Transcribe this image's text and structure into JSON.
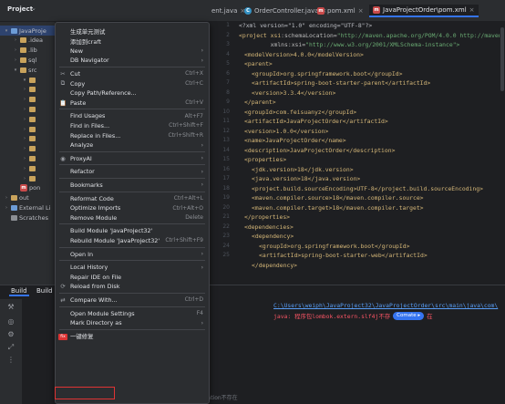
{
  "project_panel": {
    "title": "Project",
    "chevron": "⌄"
  },
  "tabs": [
    {
      "label": "ent.java",
      "icon": "c"
    },
    {
      "label": "OrderController.java",
      "icon": "c"
    },
    {
      "label": "pom.xml",
      "icon": "m"
    },
    {
      "label": "JavaProjectOrder\\pom.xml",
      "icon": "m",
      "active": true
    }
  ],
  "tree": [
    {
      "label": "JavaProje",
      "indent": 4,
      "arrow": "▾",
      "kind": "blue",
      "selected": true
    },
    {
      "label": ".idea",
      "indent": 14,
      "arrow": "›",
      "kind": "folder"
    },
    {
      "label": ".lib",
      "indent": 14,
      "arrow": "›",
      "kind": "folder"
    },
    {
      "label": "sql",
      "indent": 14,
      "arrow": "›",
      "kind": "folder"
    },
    {
      "label": "src",
      "indent": 14,
      "arrow": "▾",
      "kind": "folder"
    },
    {
      "label": "",
      "indent": 24,
      "arrow": "▾",
      "kind": "folder"
    },
    {
      "label": "",
      "indent": 24,
      "arrow": "›",
      "kind": "folder"
    },
    {
      "label": "",
      "indent": 24,
      "arrow": "›",
      "kind": "folder"
    },
    {
      "label": "",
      "indent": 24,
      "arrow": "›",
      "kind": "folder"
    },
    {
      "label": "",
      "indent": 24,
      "arrow": "›",
      "kind": "folder"
    },
    {
      "label": "",
      "indent": 24,
      "arrow": "›",
      "kind": "folder"
    },
    {
      "label": "",
      "indent": 24,
      "arrow": "›",
      "kind": "folder"
    },
    {
      "label": "",
      "indent": 24,
      "arrow": "›",
      "kind": "folder"
    },
    {
      "label": "",
      "indent": 24,
      "arrow": "›",
      "kind": "folder"
    },
    {
      "label": "",
      "indent": 24,
      "arrow": "›",
      "kind": "folder"
    },
    {
      "label": "",
      "indent": 24,
      "arrow": "›",
      "kind": "folder"
    },
    {
      "label": "pon",
      "indent": 14,
      "arrow": "",
      "kind": "pom"
    },
    {
      "label": "out",
      "indent": 4,
      "arrow": "›",
      "kind": "folder"
    },
    {
      "label": "External Li",
      "indent": 4,
      "arrow": "›",
      "kind": "lib"
    },
    {
      "label": "Scratches",
      "indent": 4,
      "arrow": "",
      "kind": "scratch"
    }
  ],
  "line_numbers": [
    "1",
    "2",
    "3",
    "4",
    "5",
    "6",
    "7",
    "8",
    "9",
    "10",
    "11",
    "12",
    "13",
    "14",
    "15",
    "16",
    "17",
    "18",
    "19",
    "20",
    "21",
    "22",
    "23",
    "24",
    "25"
  ],
  "code": {
    "l1": "<?xml version=\"1.0\" encoding=\"UTF-8\"?>",
    "l2a": "<project xsi",
    "l2b": ":schemaLocation=",
    "l2c": "\"http://maven.apache.org/POM/4.0.0 http://maven",
    "l3a": "         xmlns:xsi=",
    "l3b": "\"http://www.w3.org/2001/XMLSchema-instance\">",
    "l4": "<modelVersion>4.0.0</modelVersion>",
    "l5": "<parent>",
    "l6": "<groupId>org.springframework.boot</groupId>",
    "l7": "<artifactId>spring-boot-starter-parent</artifactId>",
    "l8": "<version>3.3.4</version>",
    "l9": "</parent>",
    "l10": "<groupId>com.feisuanyz</groupId>",
    "l11": "<artifactId>JavaProjectOrder</artifactId>",
    "l12": "<version>1.0.0</version>",
    "l13": "<name>JavaProjectOrder</name>",
    "l14": "<description>JavaProjectOrder</description>",
    "l15": "<properties>",
    "l16": "<jdk.version>18</jdk.version>",
    "l17": "<java.version>18</java.version>",
    "l18": "<project.build.sourceEncoding>UTF-8</project.build.sourceEncoding>",
    "l19": "<maven.compiler.source>18</maven.compiler.source>",
    "l20": "<maven.compiler.target>18</maven.compiler.target>",
    "l21": "</properties>",
    "l22": "<dependencies>",
    "l23": "<dependency>",
    "l24": "<groupId>org.springframework.boot</groupId>",
    "l25": "<artifactId>spring-boot-starter-web</artifactId>",
    "l26": "</dependency>"
  },
  "bottom": {
    "tab_build": "Build",
    "tab_build_out": "Build Ou",
    "path": "C:\\Users\\weiph\\JavaProject32\\JavaProjectOrder\\src\\main\\java\\com\\",
    "error_prefix": "java: 程序包lombok.extern.slf4j不存",
    "comate": "Comate",
    "comate_arrow": "▸",
    "error_suffix": "在"
  },
  "menu": [
    {
      "label": "生成单元测试",
      "shortcut": "",
      "icon": "",
      "submenu": false
    },
    {
      "label": "添加到craft",
      "shortcut": "",
      "icon": "",
      "submenu": false
    },
    {
      "label": "New",
      "shortcut": "",
      "icon": "",
      "submenu": true
    },
    {
      "label": "DB Navigator",
      "shortcut": "",
      "icon": "",
      "submenu": true
    },
    {
      "sep": true
    },
    {
      "label": "Cut",
      "shortcut": "Ctrl+X",
      "icon": "✂",
      "submenu": false
    },
    {
      "label": "Copy",
      "shortcut": "Ctrl+C",
      "icon": "⧉",
      "submenu": false
    },
    {
      "label": "Copy Path/Reference...",
      "shortcut": "",
      "icon": "",
      "submenu": false
    },
    {
      "label": "Paste",
      "shortcut": "Ctrl+V",
      "icon": "📋",
      "submenu": false
    },
    {
      "sep": true
    },
    {
      "label": "Find Usages",
      "shortcut": "Alt+F7",
      "icon": "",
      "submenu": false
    },
    {
      "label": "Find in Files...",
      "shortcut": "Ctrl+Shift+F",
      "icon": "",
      "submenu": false
    },
    {
      "label": "Replace in Files...",
      "shortcut": "Ctrl+Shift+R",
      "icon": "",
      "submenu": false
    },
    {
      "label": "Analyze",
      "shortcut": "",
      "icon": "",
      "submenu": true
    },
    {
      "sep": true
    },
    {
      "label": "ProxyAI",
      "shortcut": "",
      "icon": "◉",
      "submenu": true
    },
    {
      "sep": true
    },
    {
      "label": "Refactor",
      "shortcut": "",
      "icon": "",
      "submenu": true
    },
    {
      "sep": true
    },
    {
      "label": "Bookmarks",
      "shortcut": "",
      "icon": "",
      "submenu": true
    },
    {
      "sep": true
    },
    {
      "label": "Reformat Code",
      "shortcut": "Ctrl+Alt+L",
      "icon": "",
      "submenu": false
    },
    {
      "label": "Optimize Imports",
      "shortcut": "Ctrl+Alt+O",
      "icon": "",
      "submenu": false
    },
    {
      "label": "Remove Module",
      "shortcut": "Delete",
      "icon": "",
      "submenu": false
    },
    {
      "sep": true
    },
    {
      "label": "Build Module 'JavaProject32'",
      "shortcut": "",
      "icon": "",
      "submenu": false
    },
    {
      "label": "Rebuild Module 'JavaProject32'",
      "shortcut": "Ctrl+Shift+F9",
      "icon": "",
      "submenu": false
    },
    {
      "sep": true
    },
    {
      "label": "Open In",
      "shortcut": "",
      "icon": "",
      "submenu": true
    },
    {
      "sep": true
    },
    {
      "label": "Local History",
      "shortcut": "",
      "icon": "",
      "submenu": true
    },
    {
      "label": "Repair IDE on File",
      "shortcut": "",
      "icon": "",
      "submenu": false
    },
    {
      "label": "Reload from Disk",
      "shortcut": "",
      "icon": "⟳",
      "submenu": false
    },
    {
      "sep": true
    },
    {
      "label": "Compare With...",
      "shortcut": "Ctrl+D",
      "icon": "⇄",
      "submenu": false
    },
    {
      "sep": true
    },
    {
      "label": "Open Module Settings",
      "shortcut": "F4",
      "icon": "",
      "submenu": false
    },
    {
      "label": "Mark Directory as",
      "shortcut": "",
      "icon": "",
      "submenu": true
    },
    {
      "sep": true
    },
    {
      "label": "一键修复",
      "shortcut": "",
      "icon": "bad",
      "submenu": false,
      "highlight": true
    }
  ],
  "behind_text": "springframework.web.bind.annotation不存在",
  "colors": {
    "accent": "#3574f0",
    "error": "#f75464",
    "highlight_border": "#e03434"
  }
}
